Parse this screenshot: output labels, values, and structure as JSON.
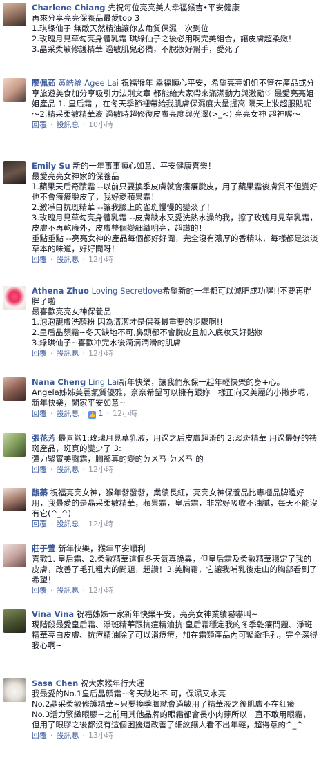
{
  "actions": {
    "reply": "回覆",
    "sep": "·",
    "translate": "設訊息"
  },
  "comments": [
    {
      "author": "Charlene Chiang",
      "mention": "",
      "lines": [
        "先祝每位亮亮美人幸福猴吉•平安健康",
        "再來分享亮亮保養品最愛top 3",
        "1.琪綠仙子  無敵天然精油讓你去角質保濕一次到位",
        "2.玫瑰月見草勾亮身體乳霜  琪綠仙子之後必用啊完美組合，讓皮膚超柔嫩！",
        "3.晶采柔敏修護精華  過敏肌兒必備，不脫妝好幫手，愛死了"
      ],
      "time": "",
      "likes": ""
    },
    {
      "author": "廖佩茹",
      "mention": "黃皓綸 Agee Lai",
      "lines": [
        "祝福猴年 幸福順心平安，希望亮亮姐姐不管在產品或分享旅遊美食加分享吸引力法則文章 都能給大家帶來滿滿動力與激勵♡ 最愛亮亮姐姐產品 1. 皇后霜 ，在冬天季節裡帶給我肌膚保濕度大量提高 隔天上妝超服貼呢～2.精采柔敏精華液 過敏時超修復皮膚亮度與光澤(>_<) 亮亮女神 超神喔～"
      ],
      "time": "10小時",
      "likes": ""
    },
    {
      "author": "Emily Su",
      "mention": "",
      "lines": [
        "新的一年事事順心如意、平安健康喜樂！",
        "最愛亮亮女神家的保養品",
        "1.蘋果天后奇蹟霜 --以前只要換季皮膚就會癢癢脫皮，用了蘋果霜後膚質不但變好也不會癢癢脫皮了，我好愛蘋果霜！",
        "2.激凈白抗斑精華 --讓我臉上的雀斑慢慢的變淡了！",
        "3.玫瑰月見草勾亮身體乳霜 --皮膚缺水又愛洗熱水澡的我，擦了玫瑰月見草乳霜，皮膚不再乾癢外，皮膚整個變細緻明亮，超讚的！",
        "重點重點 --亮亮女神的產品每個都好好聞，完全沒有濃厚的香精味，每樣都是淡淡草本的味道，好好聞呀！"
      ],
      "time": "12小時",
      "likes": ""
    },
    {
      "author": "Athena Zhuo",
      "mention": "Loving Secretlove",
      "lines": [
        "希望新的一年都可以減肥成功喔!!不要再胖胖了啦",
        "最喜歡亮亮女神保養品",
        "1.泡泡靚膚洗顏粉 因為清潔才是保養最重要的步驟啊!!",
        "2.皇后晶顏霜~冬天缺地不可,鼻頭都不會脫皮且加入底妝又好貼妝",
        "3.綠琪仙子~喜歡冲完水後滴滴潤滑的肌膚"
      ],
      "time": "12小時",
      "likes": ""
    },
    {
      "author": "Nana Cheng",
      "mention": "Ling Lai",
      "lines": [
        "新年快樂，讓我們永保一起年輕快樂的身+心。",
        "Angela姊姊美麗氣質優雅，奈奈希望可以擁有跟妳一樣正向又美麗的小撇步呢，新年快樂，闔家平安如意~"
      ],
      "time": "12小時",
      "likes": "1"
    },
    {
      "author": "張花芳",
      "mention": "",
      "lines": [
        "最喜歡1:玫瑰月見草乳液，用過之后皮膚超滑的 2:淡斑精華 用過最好的祛斑産品，斑真的變少了 3:",
        "彈力緊實美胸霜，胸部真的變的ㄉㄨㄢ ㄉㄨㄢ 的"
      ],
      "time": "12小時",
      "likes": ""
    },
    {
      "author": "馥蓁",
      "mention": "",
      "lines": [
        "祝福亮亮女神，猴年發發發，業績長紅，亮亮女神保養品比專櫃品牌還好用，我最愛的是晶采柔敏精華，蘋果霜，皇后霜，非常好吸收不油膩，每天不能沒有它(^_^)"
      ],
      "time": "12小時",
      "likes": ""
    },
    {
      "author": "莊于萱",
      "mention": "",
      "lines": [
        "新年快樂，猴年平安順利",
        "喜歡1. 皇后霜、2.柔敏精華這個冬天氣真詭異，但皇后霜及柔敏精華穩定了我的皮膚，改善了毛孔粗大的問題，超讚！3.美胸霜，它讓我哺乳後走山的胸部看到了希望！"
      ],
      "time": "12小時",
      "likes": ""
    },
    {
      "author": "Vina Vina",
      "mention": "",
      "lines": [
        "祝福姊姊一家新年快樂平安，亮亮女神業績嚇嚇叫~",
        "現階段最愛皇后霜、淨斑精華跟抗痘精油抗:皇后霜穩定我的冬季乾癢問題、淨斑精華亮白皮膚、抗痘精油除了可以消痘痘，加在霜類產品內可緊緻毛孔，完全深得我心啊~"
      ],
      "time": "12小時",
      "likes": ""
    },
    {
      "author": "Sasa Chen",
      "mention": "",
      "lines": [
        "祝大家猴年行大運",
        "我最愛的No.1皇后晶顏霜~冬天缺地不 可，保濕又水亮",
        "No.2晶采柔敏修護精華~只要換季臉就會過敏用了精華液之後肌膚不在紅癢",
        "No.3活力緊緻眼膠~之前用其他品牌的眼霜都會長小肉芽所以一直不敢用眼霜，但用了眼膠之後都沒有這個困擾還改善了細紋讓人看不出年輕，超得意的^_^"
      ],
      "time": "13小時",
      "likes": ""
    }
  ]
}
